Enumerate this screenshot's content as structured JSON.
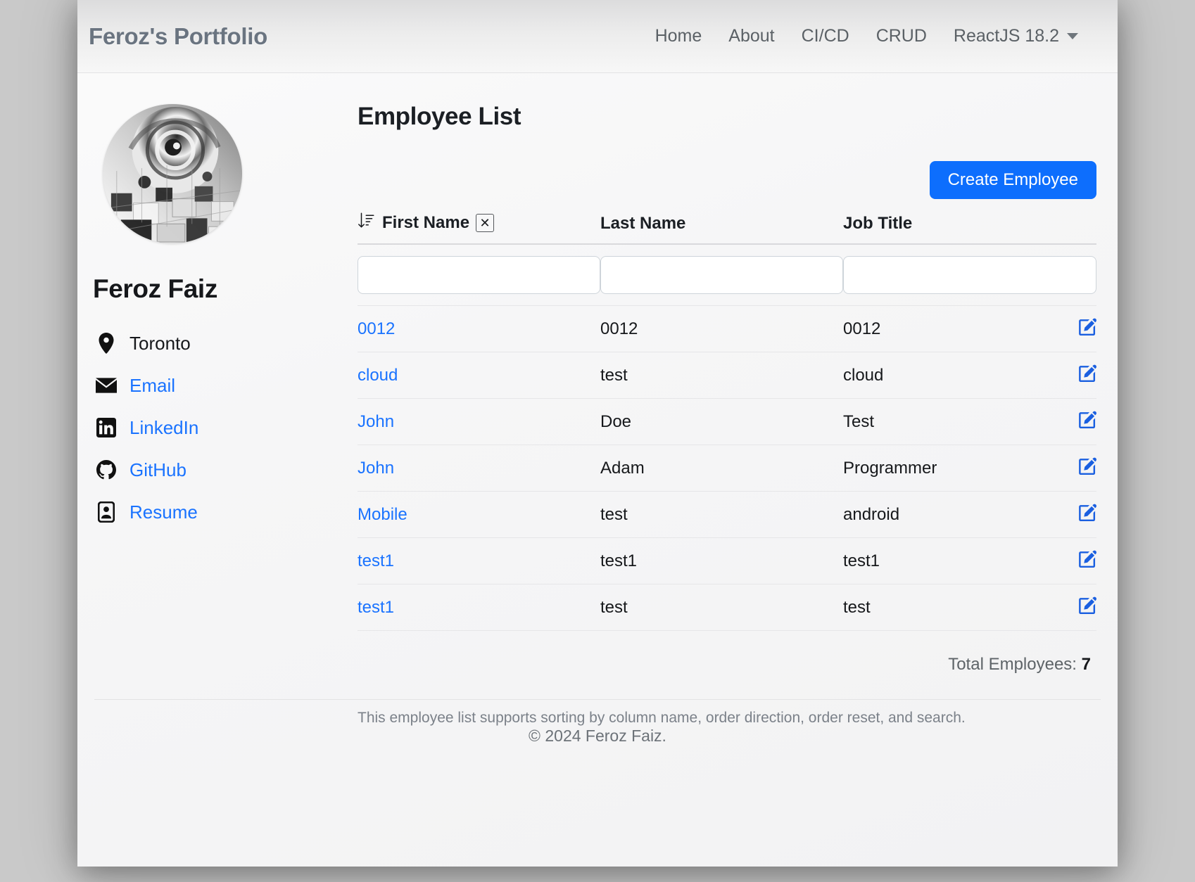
{
  "navbar": {
    "brand": "Feroz's Portfolio",
    "links": [
      {
        "label": "Home"
      },
      {
        "label": "About"
      },
      {
        "label": "CI/CD"
      },
      {
        "label": "CRUD"
      }
    ],
    "dropdown": {
      "label": "ReactJS 18.2",
      "icon": "chevron-down-icon"
    }
  },
  "sidebar": {
    "avatar_alt": "abstract-grayscale-avatar",
    "name": "Feroz Faiz",
    "items": [
      {
        "label": "Toronto",
        "icon": "location-pin-icon",
        "is_link": false
      },
      {
        "label": "Email",
        "icon": "envelope-icon",
        "is_link": true
      },
      {
        "label": "LinkedIn",
        "icon": "linkedin-icon",
        "is_link": true
      },
      {
        "label": "GitHub",
        "icon": "github-icon",
        "is_link": true
      },
      {
        "label": "Resume",
        "icon": "person-badge-icon",
        "is_link": true
      }
    ]
  },
  "main": {
    "title": "Employee List",
    "create_button": "Create Employee",
    "columns": {
      "first_name": "First Name",
      "last_name": "Last Name",
      "job_title": "Job Title"
    },
    "sort": {
      "icon": "sort-alpha-down-icon",
      "active_column": "First Name",
      "reset_label": "✕"
    },
    "filters": {
      "first_name_value": "",
      "last_name_value": "",
      "job_title_value": "",
      "first_name_placeholder": "",
      "last_name_placeholder": "",
      "job_title_placeholder": ""
    },
    "rows": [
      {
        "first_name": "0012",
        "last_name": "0012",
        "job_title": "0012",
        "action_icon": "edit-pencil-square-icon"
      },
      {
        "first_name": "cloud",
        "last_name": "test",
        "job_title": "cloud",
        "action_icon": "edit-pencil-square-icon"
      },
      {
        "first_name": "John",
        "last_name": "Doe",
        "job_title": "Test",
        "action_icon": "edit-pencil-square-icon"
      },
      {
        "first_name": "John",
        "last_name": "Adam",
        "job_title": "Programmer",
        "action_icon": "edit-pencil-square-icon"
      },
      {
        "first_name": "Mobile",
        "last_name": "test",
        "job_title": "android",
        "action_icon": "edit-pencil-square-icon"
      },
      {
        "first_name": "test1",
        "last_name": "test1",
        "job_title": "test1",
        "action_icon": "edit-pencil-square-icon"
      },
      {
        "first_name": "test1",
        "last_name": "test",
        "job_title": "test",
        "action_icon": "edit-pencil-square-icon"
      }
    ],
    "total_label": "Total Employees:",
    "total_count": "7",
    "help_text": "This employee list supports sorting by column name, order direction, order reset, and search."
  },
  "footer": {
    "copyright": "© 2024 Feroz Faiz."
  },
  "colors": {
    "primary": "#0d6efd",
    "link": "#1a73ff",
    "brand_text": "#6a7480",
    "nav_text": "#5b6166",
    "muted": "#7b8189"
  }
}
